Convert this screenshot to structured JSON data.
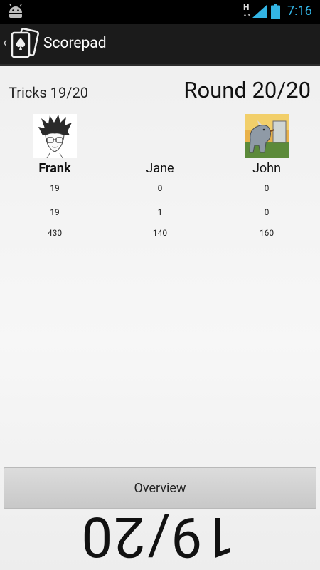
{
  "status_bar": {
    "network_type": "H",
    "net_arrows": "▲▼",
    "time": "7:16"
  },
  "action_bar": {
    "up_glyph": "‹",
    "title": "Scorepad",
    "app_icon": "playing-cards-spade-icon"
  },
  "header": {
    "tricks": "Tricks 19/20",
    "round": "Round 20/20"
  },
  "players": [
    {
      "name": "Frank",
      "bold": true,
      "avatar": "sketch-portrait-avatar",
      "stats": [
        "19",
        "19",
        "430"
      ]
    },
    {
      "name": "Jane",
      "bold": false,
      "avatar": "",
      "stats": [
        "0",
        "1",
        "140"
      ]
    },
    {
      "name": "John",
      "bold": false,
      "avatar": "rhino-painting-avatar",
      "stats": [
        "0",
        "0",
        "160"
      ]
    }
  ],
  "overview_label": "Overview",
  "big_fraction": "19/20",
  "colors": {
    "clock": "#33b5e5",
    "action_bar": "#1b1b1b",
    "button": "#d0d0d0"
  }
}
